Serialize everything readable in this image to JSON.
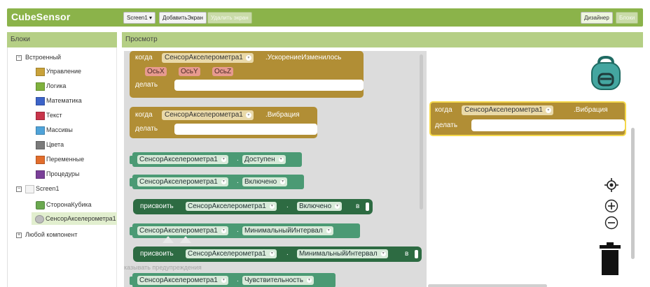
{
  "app": {
    "title": "CubeSensor"
  },
  "toolbar": {
    "screen_select": "Screen1 ▾",
    "add_screen": "ДобавитьЭкран",
    "remove_screen": "Удалить экран",
    "designer": "Дизайнер",
    "blocks": "Блоки"
  },
  "blocks_panel": {
    "title": "Блоки",
    "builtin": "Встроенный",
    "builtin_items": [
      {
        "label": "Управление",
        "color": "#c9a23a"
      },
      {
        "label": "Логика",
        "color": "#7fb13d"
      },
      {
        "label": "Математика",
        "color": "#3c63c9"
      },
      {
        "label": "Текст",
        "color": "#c8344a"
      },
      {
        "label": "Массивы",
        "color": "#4fa3d9"
      },
      {
        "label": "Цвета",
        "color": "#7a7a7a"
      },
      {
        "label": "Переменные",
        "color": "#e26d2c"
      },
      {
        "label": "Процедуры",
        "color": "#7a3f98"
      }
    ],
    "screen": "Screen1",
    "screen_items": [
      "СторонаКубика",
      "СенсорАкселерометра1"
    ],
    "any_component": "Любой компонент",
    "expander_minus": "⊟",
    "expander_plus": "⊞"
  },
  "preview": {
    "title": "Просмотр"
  },
  "flyout": {
    "ev1": {
      "when": "когда",
      "component": "СенсорАкселерометра1",
      "event": ".УскорениеИзменилось",
      "params": [
        "ОсьX",
        "ОсьY",
        "ОсьZ"
      ],
      "do": "делать"
    },
    "ev2": {
      "when": "когда",
      "component": "СенсорАкселерометра1",
      "event": ".Вибрация",
      "do": "делать"
    },
    "getters": [
      {
        "component": "СенсорАкселерометра1",
        "property": "Доступен"
      },
      {
        "component": "СенсорАкселерометра1",
        "property": "Включено"
      }
    ],
    "setter1": {
      "set": "присвоить",
      "component": "СенсорАкселерометра1",
      "property": "Включено",
      "to": "в"
    },
    "getter3": {
      "component": "СенсорАкселерометра1",
      "property": "МинимальныйИнтервал"
    },
    "setter2": {
      "set": "присвоить",
      "component": "СенсорАкселерометра1",
      "property": "МинимальныйИнтервал",
      "to": "в"
    },
    "getter4": {
      "component": "СенсорАкселерометра1",
      "property": "Чувствительность"
    },
    "warnings": "казывать предупреждения",
    "dot": "."
  },
  "canvas": {
    "block": {
      "when": "когда",
      "component": "СенсорАкселерометра1",
      "event": ".Вибрация",
      "do": "делать"
    }
  },
  "colors": {
    "brand": "#8bb34a",
    "event": "#b18e35",
    "component": "#4b9a74",
    "setter": "#2d6b42"
  },
  "icons": [
    "backpack-icon",
    "target-icon",
    "zoom-in-icon",
    "zoom-out-icon",
    "trash-icon"
  ]
}
